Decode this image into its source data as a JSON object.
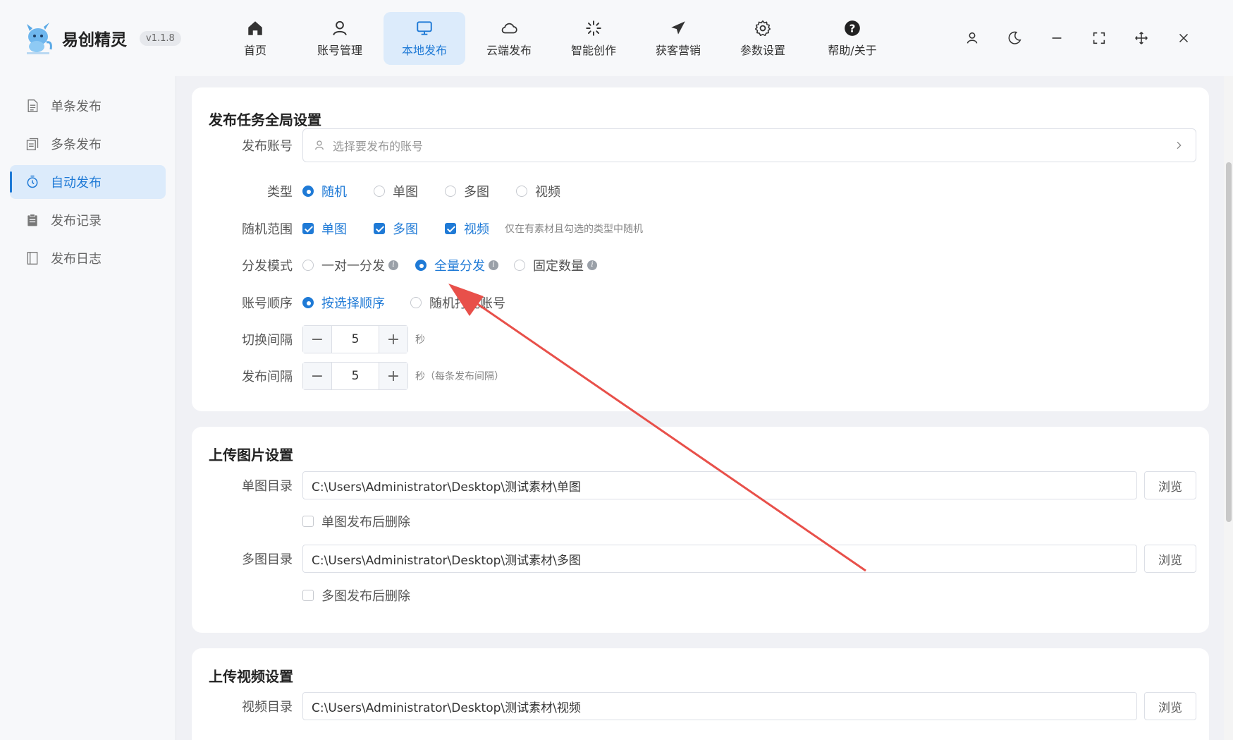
{
  "app": {
    "name": "易创精灵",
    "version": "v1.1.8"
  },
  "nav": [
    {
      "label": "首页",
      "icon": "home-icon"
    },
    {
      "label": "账号管理",
      "icon": "user-icon"
    },
    {
      "label": "本地发布",
      "icon": "monitor-icon"
    },
    {
      "label": "云端发布",
      "icon": "cloud-icon"
    },
    {
      "label": "智能创作",
      "icon": "sparkle-icon"
    },
    {
      "label": "获客营销",
      "icon": "send-icon"
    },
    {
      "label": "参数设置",
      "icon": "gear-icon"
    },
    {
      "label": "帮助/关于",
      "icon": "help-icon"
    }
  ],
  "sidebar": [
    {
      "label": "单条发布",
      "icon": "document-icon"
    },
    {
      "label": "多条发布",
      "icon": "documents-icon"
    },
    {
      "label": "自动发布",
      "icon": "timer-icon"
    },
    {
      "label": "发布记录",
      "icon": "clipboard-icon"
    },
    {
      "label": "发布日志",
      "icon": "log-icon"
    }
  ],
  "global": {
    "title": "发布任务全局设置",
    "account": {
      "label": "发布账号",
      "placeholder": "选择要发布的账号"
    },
    "type": {
      "label": "类型",
      "options": [
        "随机",
        "单图",
        "多图",
        "视频"
      ],
      "selected": "随机"
    },
    "range": {
      "label": "随机范围",
      "options": [
        "单图",
        "多图",
        "视频"
      ],
      "hint": "仅在有素材且勾选的类型中随机"
    },
    "mode": {
      "label": "分发模式",
      "options": [
        "一对一分发",
        "全量分发",
        "固定数量"
      ],
      "selected": "全量分发"
    },
    "order": {
      "label": "账号顺序",
      "options": [
        "按选择顺序",
        "随机打乱账号"
      ],
      "selected": "按选择顺序"
    },
    "switch": {
      "label": "切换间隔",
      "value": "5",
      "unit": "秒"
    },
    "publish": {
      "label": "发布间隔",
      "value": "5",
      "unit": "秒（每条发布间隔）"
    }
  },
  "image_upload": {
    "title": "上传图片设置",
    "single": {
      "label": "单图目录",
      "path": "C:\\Users\\Administrator\\Desktop\\测试素材\\单图",
      "browse": "浏览",
      "delete_label": "单图发布后删除"
    },
    "multi": {
      "label": "多图目录",
      "path": "C:\\Users\\Administrator\\Desktop\\测试素材\\多图",
      "browse": "浏览",
      "delete_label": "多图发布后删除"
    }
  },
  "video_upload": {
    "title": "上传视频设置",
    "video": {
      "label": "视频目录",
      "path": "C:\\Users\\Administrator\\Desktop\\测试素材\\视频",
      "browse": "浏览"
    }
  },
  "colors": {
    "accent": "#1f7ad6",
    "arrow": "#e8504a",
    "active_bg": "#dcebfb"
  }
}
